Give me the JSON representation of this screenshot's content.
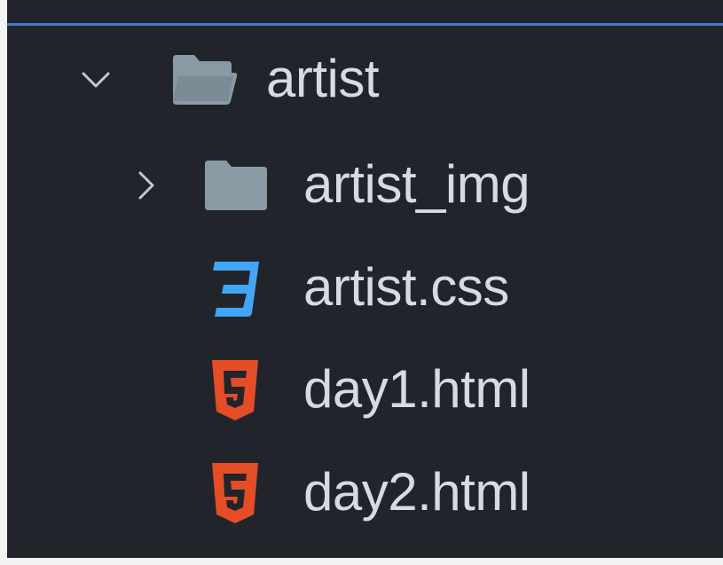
{
  "explorer": {
    "items": [
      {
        "label": "artist",
        "type": "folder",
        "expanded": true,
        "chevron": "chevron-down-icon",
        "icon": "folder-open-icon"
      },
      {
        "label": "artist_img",
        "type": "folder",
        "expanded": false,
        "chevron": "chevron-right-icon",
        "icon": "folder-icon"
      },
      {
        "label": "artist.css",
        "type": "file",
        "icon": "css-file-icon"
      },
      {
        "label": "day1.html",
        "type": "file",
        "icon": "html-file-icon"
      },
      {
        "label": "day2.html",
        "type": "file",
        "icon": "html-file-icon"
      }
    ]
  },
  "colors": {
    "background": "#21252b",
    "focus_line": "#3e7bd6",
    "text": "#d7dae0",
    "folder": "#8a9aa5",
    "css_icon": "#42a5f5",
    "html_icon": "#e44d26"
  }
}
